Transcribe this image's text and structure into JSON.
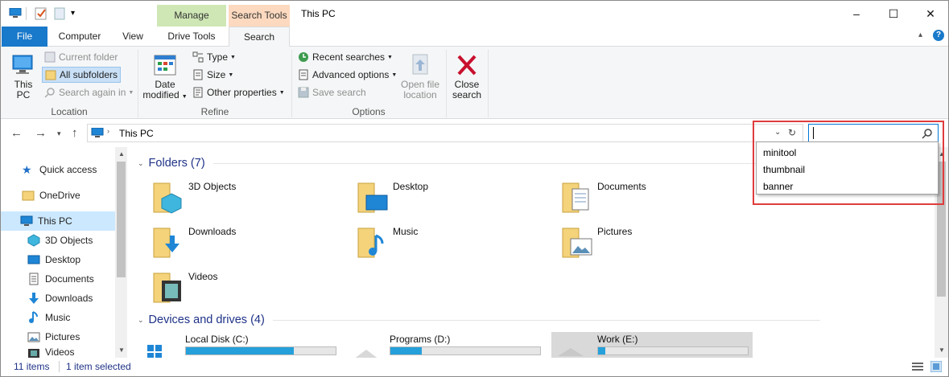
{
  "window": {
    "title": "This PC",
    "context_tabs": {
      "manage": "Manage",
      "search_tools": "Search Tools"
    },
    "controls": {
      "minimize": "–",
      "maximize": "☐",
      "close": "✕"
    }
  },
  "tabs": {
    "file": "File",
    "computer": "Computer",
    "view": "View",
    "drive_tools": "Drive Tools",
    "search": "Search"
  },
  "ribbon": {
    "location": {
      "label": "Location",
      "this_pc": "This\nPC",
      "this_pc_line1": "This",
      "this_pc_line2": "PC",
      "current_folder": "Current folder",
      "all_subfolders": "All subfolders",
      "search_again_in": "Search again in"
    },
    "refine": {
      "label": "Refine",
      "date_modified_line1": "Date",
      "date_modified_line2": "modified",
      "type": "Type",
      "size": "Size",
      "other_properties": "Other properties"
    },
    "options": {
      "label": "Options",
      "recent_searches": "Recent searches",
      "advanced_options": "Advanced options",
      "save_search": "Save search",
      "open_file_location_line1": "Open file",
      "open_file_location_line2": "location"
    },
    "close": {
      "line1": "Close",
      "line2": "search"
    }
  },
  "address": {
    "path": "This PC",
    "search_value": ""
  },
  "suggestions": [
    "minitool",
    "thumbnail",
    "banner"
  ],
  "nav": {
    "quick_access": "Quick access",
    "onedrive": "OneDrive",
    "this_pc": "This PC",
    "items": [
      "3D Objects",
      "Desktop",
      "Documents",
      "Downloads",
      "Music",
      "Pictures",
      "Videos"
    ]
  },
  "content": {
    "folders_header": "Folders (7)",
    "folders": [
      "3D Objects",
      "Desktop",
      "Documents",
      "Downloads",
      "Music",
      "Pictures",
      "Videos"
    ],
    "devices_header": "Devices and drives (4)",
    "drives": [
      {
        "label": "Local Disk (C:)",
        "used_fraction": 0.72
      },
      {
        "label": "Programs (D:)",
        "used_fraction": 0.21
      },
      {
        "label": "Work (E:)",
        "used_fraction": 0.05
      }
    ]
  },
  "status": {
    "count": "11 items",
    "selected": "1 item selected"
  },
  "colors": {
    "accent": "#1979ca",
    "highlight": "#e03c3c",
    "bar": "#26a0da",
    "manage": "#cfe7b5",
    "search_tools": "#fcd9bf"
  }
}
